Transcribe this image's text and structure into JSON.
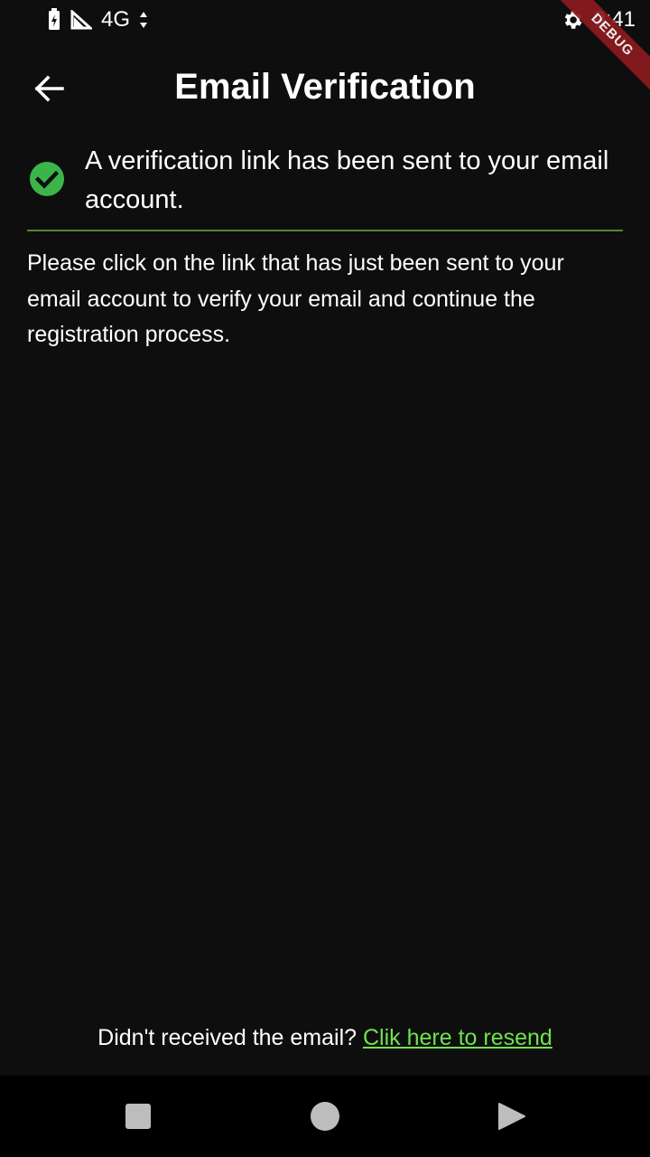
{
  "status_bar": {
    "network": "4G",
    "time": "9:41",
    "icons": [
      "battery-icon",
      "signal-icon",
      "data-arrows-icon",
      "settings-icon"
    ]
  },
  "debug_banner": "DEBUG",
  "app_bar": {
    "title": "Email Verification",
    "back_icon": "arrow-left-icon"
  },
  "message": {
    "icon": "check-circle-icon",
    "text": "A verification link has been sent to your email account."
  },
  "instructions": "Please click on the link that has just been sent to your email account to verify your email and continue the registration process.",
  "resend": {
    "prompt": "Didn't received the email? ",
    "link_label": "Clik here to resend"
  },
  "colors": {
    "background": "#0e0e0e",
    "accent_green": "#6de34f",
    "check_green": "#3bb54a",
    "divider": "#4f8a2c",
    "debug_ribbon": "#8b1a1f"
  },
  "nav_bar": {
    "icons": [
      "recent-apps-icon",
      "home-icon",
      "back-triangle-icon"
    ]
  }
}
